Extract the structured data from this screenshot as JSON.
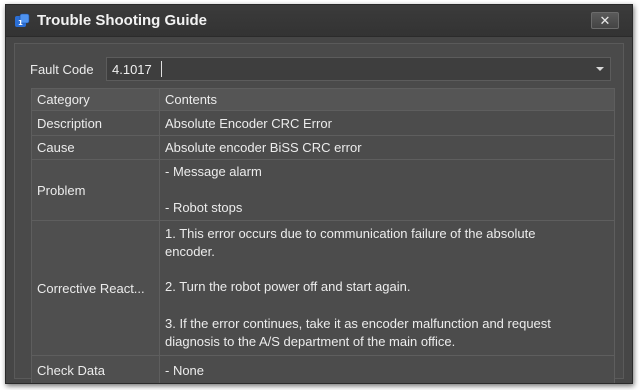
{
  "window": {
    "title": "Trouble Shooting Guide",
    "close_label": "✕"
  },
  "fault_code": {
    "label": "Fault Code",
    "value": "4.1017"
  },
  "table": {
    "headers": [
      "Category",
      "Contents"
    ],
    "rows": [
      {
        "category": "Description",
        "lines": [
          "Absolute Encoder CRC Error"
        ]
      },
      {
        "category": "Cause",
        "lines": [
          "Absolute encoder BiSS CRC error"
        ]
      },
      {
        "category": "Problem",
        "lines": [
          "- Message alarm",
          "- Robot stops"
        ]
      },
      {
        "category": "Corrective React...",
        "lines": [
          "1. This error occurs due to communication failure of the absolute",
          "encoder.",
          "2. Turn the robot power off and start again.",
          "3. If the error continues, take it as encoder malfunction and request",
          "diagnosis to the A/S department of the main office."
        ]
      },
      {
        "category": "Check Data",
        "lines": [
          "- None"
        ]
      }
    ]
  },
  "colors": {
    "window_bg": "#464646",
    "title_text": "#f2f2f2",
    "icon_blue": "#2b6fd6"
  },
  "icons": {
    "app": "app-icon",
    "close": "close-icon",
    "dropdown": "chevron-down-icon"
  }
}
